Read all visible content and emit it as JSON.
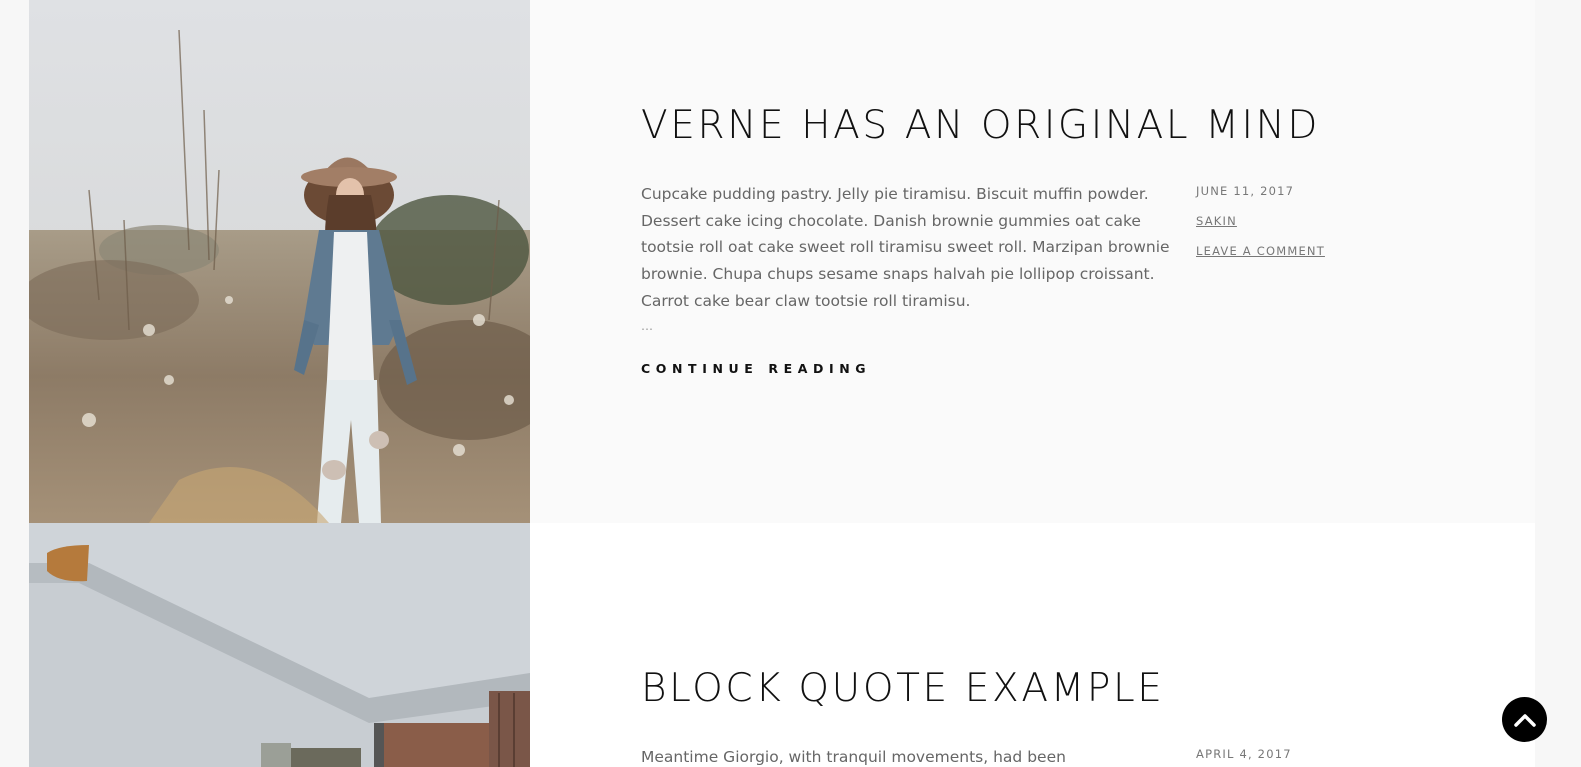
{
  "posts": [
    {
      "title": "VERNE HAS AN ORIGINAL MIND",
      "excerpt": "Cupcake pudding pastry. Jelly pie tiramisu. Biscuit muffin powder. Dessert cake icing chocolate. Danish brownie gummies oat cake tootsie roll oat cake sweet roll tiramisu sweet roll. Marzipan brownie brownie. Chupa chups sesame snaps halvah pie lollipop croissant. Carrot cake bear claw tootsie roll tiramisu.",
      "ellipsis": "…",
      "date": "JUNE 11, 2017",
      "author": "SAKIN",
      "comments": "LEAVE A COMMENT",
      "continue_label": "CONTINUE READING"
    },
    {
      "title": "BLOCK QUOTE EXAMPLE",
      "excerpt": "Meantime Giorgio, with tranquil movements, had been",
      "date": "APRIL 4, 2017"
    }
  ],
  "scroll_top": {
    "icon": "chevron-up-icon"
  }
}
